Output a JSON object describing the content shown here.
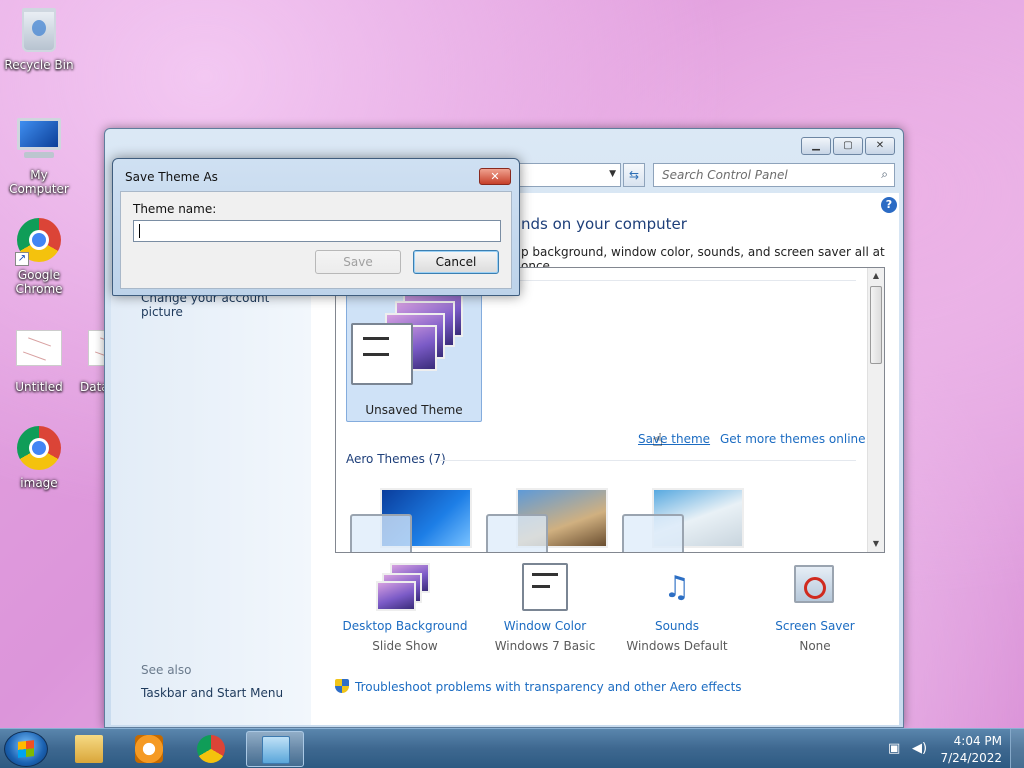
{
  "desktop": {
    "icons": [
      {
        "label": "Recycle Bin",
        "icon": "recycle-bin-icon"
      },
      {
        "label": "My Computer",
        "icon": "computer-icon"
      },
      {
        "label": "Google Chrome",
        "icon": "chrome-icon"
      },
      {
        "label": "Untitled",
        "icon": "document-icon"
      },
      {
        "label": "Data",
        "icon": "document-icon"
      },
      {
        "label": "image",
        "icon": "chrome-icon"
      }
    ]
  },
  "window": {
    "search_placeholder": "Search Control Panel",
    "heading": "nds on your computer",
    "subtext": "p background, window color, sounds, and screen saver all at once.",
    "left_links": {
      "account_picture": "Change your account picture",
      "see_also": "See also",
      "taskbar": "Taskbar and Start Menu"
    },
    "themes": {
      "unsaved_label": "Unsaved Theme",
      "save_theme": "Save theme",
      "get_more": "Get more themes online",
      "aero_heading": "Aero Themes (7)"
    },
    "bottom": [
      {
        "title": "Desktop Background",
        "sub": "Slide Show"
      },
      {
        "title": "Window Color",
        "sub": "Windows 7 Basic"
      },
      {
        "title": "Sounds",
        "sub": "Windows Default"
      },
      {
        "title": "Screen Saver",
        "sub": "None"
      }
    ],
    "troubleshoot": "Troubleshoot problems with transparency and other Aero effects"
  },
  "dialog": {
    "title": "Save Theme As",
    "label": "Theme name:",
    "input_value": "",
    "save_label": "Save",
    "cancel_label": "Cancel"
  },
  "taskbar": {
    "time": "4:04 PM",
    "date": "7/24/2022"
  },
  "colors": {
    "link": "#1c6cc2",
    "heading": "#1e3f7a"
  }
}
